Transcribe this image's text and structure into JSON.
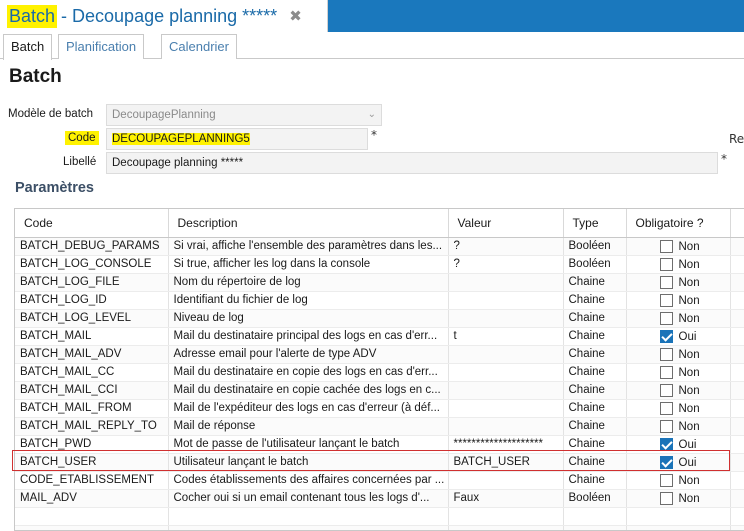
{
  "window": {
    "title_highlight": "Batch",
    "title_rest": "- Decoupage planning *****",
    "close_glyph": "✖"
  },
  "tabs": [
    "Batch",
    "Planification",
    "Calendrier"
  ],
  "heading": "Batch",
  "form": {
    "model_label": "Modèle de batch",
    "model_value": "DecoupagePlanning",
    "code_label": "Code",
    "code_value": "DECOUPAGEPLANNING5",
    "libelle_label": "Libellé",
    "libelle_value": "Decoupage planning *****",
    "required_mark": "*",
    "res_label": "Res"
  },
  "section_title": "Paramètres",
  "table": {
    "headers": [
      "Code",
      "Description",
      "Valeur",
      "Type",
      "Obligatoire ?"
    ],
    "rows": [
      {
        "code": "BATCH_DEBUG_PARAMS",
        "description": "Si vrai, affiche l'ensemble des paramètres dans les...",
        "valeur": "?",
        "type": "Booléen",
        "checked": false,
        "label": "Non"
      },
      {
        "code": "BATCH_LOG_CONSOLE",
        "description": "Si true, afficher les log dans la console",
        "valeur": "?",
        "type": "Booléen",
        "checked": false,
        "label": "Non"
      },
      {
        "code": "BATCH_LOG_FILE",
        "description": "Nom du répertoire de log",
        "valeur": "",
        "type": "Chaine",
        "checked": false,
        "label": "Non"
      },
      {
        "code": "BATCH_LOG_ID",
        "description": "Identifiant du fichier de log",
        "valeur": "",
        "type": "Chaine",
        "checked": false,
        "label": "Non"
      },
      {
        "code": "BATCH_LOG_LEVEL",
        "description": "Niveau de log",
        "valeur": "",
        "type": "Chaine",
        "checked": false,
        "label": "Non"
      },
      {
        "code": "BATCH_MAIL",
        "description": "Mail du destinataire principal des logs en cas d'err...",
        "valeur": "t",
        "type": "Chaine",
        "checked": true,
        "label": "Oui"
      },
      {
        "code": "BATCH_MAIL_ADV",
        "description": "Adresse email pour l'alerte de type ADV",
        "valeur": "",
        "type": "Chaine",
        "checked": false,
        "label": "Non"
      },
      {
        "code": "BATCH_MAIL_CC",
        "description": "Mail du destinataire en copie des logs en cas d'err...",
        "valeur": "",
        "type": "Chaine",
        "checked": false,
        "label": "Non"
      },
      {
        "code": "BATCH_MAIL_CCI",
        "description": "Mail du destinataire en copie cachée des logs en c...",
        "valeur": "",
        "type": "Chaine",
        "checked": false,
        "label": "Non"
      },
      {
        "code": "BATCH_MAIL_FROM",
        "description": "Mail de l'expéditeur des logs en cas d'erreur (à déf...",
        "valeur": "",
        "type": "Chaine",
        "checked": false,
        "label": "Non"
      },
      {
        "code": "BATCH_MAIL_REPLY_TO",
        "description": "Mail de réponse",
        "valeur": "",
        "type": "Chaine",
        "checked": false,
        "label": "Non"
      },
      {
        "code": "BATCH_PWD",
        "description": "Mot de passe de l'utilisateur lançant le batch",
        "valeur": "********************",
        "type": "Chaine",
        "checked": true,
        "label": "Oui"
      },
      {
        "code": "BATCH_USER",
        "description": "Utilisateur lançant le batch",
        "valeur": "BATCH_USER",
        "type": "Chaine",
        "checked": true,
        "label": "Oui"
      },
      {
        "code": "CODE_ETABLISSEMENT",
        "description": "Codes établissements des affaires concernées par ...",
        "valeur": "",
        "type": "Chaine",
        "checked": false,
        "label": "Non"
      },
      {
        "code": "MAIL_ADV",
        "description": "Cocher oui si un email contenant tous les logs d'...",
        "valeur": "Faux",
        "type": "Booléen",
        "checked": false,
        "label": "Non"
      }
    ]
  }
}
